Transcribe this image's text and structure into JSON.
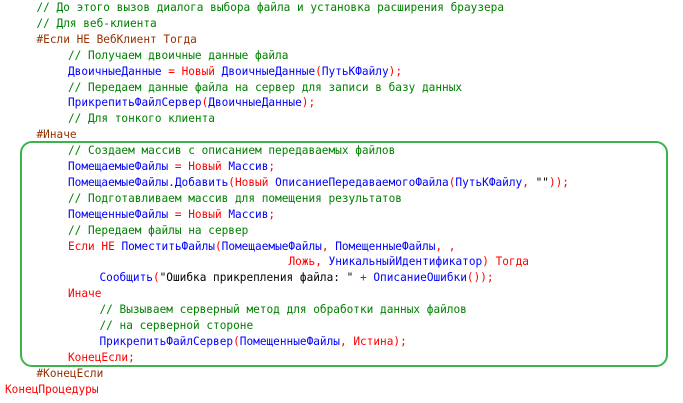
{
  "editor": {
    "colors": {
      "comment": "#008000",
      "keyword": "#ff0000",
      "identifier": "#0000ff",
      "string": "#000000",
      "preprocessor": "#963200",
      "highlight_frame": "#3cb44b"
    },
    "lines": [
      {
        "indent": 1,
        "tokens": [
          {
            "t": "comment",
            "v": "// До этого вызов диалога выбора файла и установка расширения браузера"
          }
        ]
      },
      {
        "indent": 1,
        "tokens": [
          {
            "t": "comment",
            "v": "// Для веб-клиента"
          }
        ]
      },
      {
        "indent": 1,
        "tokens": [
          {
            "t": "preproc",
            "v": "#Если НЕ ВебКлиент Тогда"
          }
        ]
      },
      {
        "indent": 2,
        "tokens": [
          {
            "t": "comment",
            "v": "// Получаем двоичные данные файла"
          }
        ]
      },
      {
        "indent": 2,
        "tokens": [
          {
            "t": "ident",
            "v": "ДвоичныеДанные "
          },
          {
            "t": "op",
            "v": "="
          },
          {
            "t": "ident",
            "v": " "
          },
          {
            "t": "keyword",
            "v": "Новый"
          },
          {
            "t": "ident",
            "v": " ДвоичныеДанные"
          },
          {
            "t": "op",
            "v": "("
          },
          {
            "t": "ident",
            "v": "ПутьКФайлу"
          },
          {
            "t": "op",
            "v": ");"
          }
        ]
      },
      {
        "indent": 2,
        "tokens": [
          {
            "t": "comment",
            "v": "// Передаем данные файла на сервер для записи в базу данных"
          }
        ]
      },
      {
        "indent": 2,
        "tokens": [
          {
            "t": "ident",
            "v": "ПрикрепитьФайлСервер"
          },
          {
            "t": "op",
            "v": "("
          },
          {
            "t": "ident",
            "v": "ДвоичныеДанные"
          },
          {
            "t": "op",
            "v": ");"
          }
        ]
      },
      {
        "indent": 2,
        "tokens": [
          {
            "t": "comment",
            "v": "// Для тонкого клиента"
          }
        ]
      },
      {
        "indent": 1,
        "tokens": [
          {
            "t": "preproc",
            "v": "#Иначе"
          }
        ]
      },
      {
        "indent": 2,
        "tokens": [
          {
            "t": "comment",
            "v": "// Создаем массив с описанием передаваемых файлов"
          }
        ]
      },
      {
        "indent": 2,
        "tokens": [
          {
            "t": "ident",
            "v": "ПомещаемыеФайлы "
          },
          {
            "t": "op",
            "v": "="
          },
          {
            "t": "ident",
            "v": " "
          },
          {
            "t": "keyword",
            "v": "Новый"
          },
          {
            "t": "ident",
            "v": " Массив"
          },
          {
            "t": "op",
            "v": ";"
          }
        ]
      },
      {
        "indent": 2,
        "tokens": [
          {
            "t": "ident",
            "v": "ПомещаемыеФайлы.Добавить"
          },
          {
            "t": "op",
            "v": "("
          },
          {
            "t": "keyword",
            "v": "Новый"
          },
          {
            "t": "ident",
            "v": " ОписаниеПередаваемогоФайла"
          },
          {
            "t": "op",
            "v": "("
          },
          {
            "t": "ident",
            "v": "ПутьКФайлу"
          },
          {
            "t": "op",
            "v": ", "
          },
          {
            "t": "string",
            "v": "\"\""
          },
          {
            "t": "op",
            "v": "));"
          }
        ]
      },
      {
        "indent": 2,
        "tokens": [
          {
            "t": "comment",
            "v": "// Подготавливаем массив для помещения результатов"
          }
        ]
      },
      {
        "indent": 2,
        "tokens": [
          {
            "t": "ident",
            "v": "ПомещенныеФайлы "
          },
          {
            "t": "op",
            "v": "="
          },
          {
            "t": "ident",
            "v": " "
          },
          {
            "t": "keyword",
            "v": "Новый"
          },
          {
            "t": "ident",
            "v": " Массив"
          },
          {
            "t": "op",
            "v": ";"
          }
        ]
      },
      {
        "indent": 2,
        "tokens": [
          {
            "t": "comment",
            "v": "// Передаем файлы на сервер"
          }
        ]
      },
      {
        "indent": 2,
        "tokens": [
          {
            "t": "keyword",
            "v": "Если НЕ"
          },
          {
            "t": "ident",
            "v": " ПоместитьФайлы"
          },
          {
            "t": "op",
            "v": "("
          },
          {
            "t": "ident",
            "v": "ПомещаемыеФайлы"
          },
          {
            "t": "op",
            "v": ", "
          },
          {
            "t": "ident",
            "v": "ПомещенныеФайлы"
          },
          {
            "t": "op",
            "v": ", ,"
          }
        ]
      },
      {
        "indent": 9,
        "tokens": [
          {
            "t": "keyword",
            "v": "Ложь"
          },
          {
            "t": "op",
            "v": ", "
          },
          {
            "t": "ident",
            "v": "УникальныйИдентификатор"
          },
          {
            "t": "op",
            "v": ")"
          },
          {
            "t": "ident",
            "v": " "
          },
          {
            "t": "keyword",
            "v": "Тогда"
          }
        ]
      },
      {
        "indent": 3,
        "tokens": [
          {
            "t": "ident",
            "v": "Сообщить"
          },
          {
            "t": "op",
            "v": "("
          },
          {
            "t": "string",
            "v": "\"Ошибка прикрепления файла: \""
          },
          {
            "t": "ident",
            "v": " "
          },
          {
            "t": "op",
            "v": "+"
          },
          {
            "t": "ident",
            "v": " ОписаниеОшибки"
          },
          {
            "t": "op",
            "v": "());"
          }
        ]
      },
      {
        "indent": 2,
        "tokens": [
          {
            "t": "keyword",
            "v": "Иначе"
          }
        ]
      },
      {
        "indent": 3,
        "tokens": [
          {
            "t": "comment",
            "v": "// Вызываем серверный метод для обработки данных файлов"
          }
        ]
      },
      {
        "indent": 3,
        "tokens": [
          {
            "t": "comment",
            "v": "// на серверной стороне"
          }
        ]
      },
      {
        "indent": 3,
        "tokens": [
          {
            "t": "ident",
            "v": "ПрикрепитьФайлСервер"
          },
          {
            "t": "op",
            "v": "("
          },
          {
            "t": "ident",
            "v": "ПомещенныеФайлы"
          },
          {
            "t": "op",
            "v": ", "
          },
          {
            "t": "keyword",
            "v": "Истина"
          },
          {
            "t": "op",
            "v": ");"
          }
        ]
      },
      {
        "indent": 2,
        "tokens": [
          {
            "t": "keyword",
            "v": "КонецЕсли"
          },
          {
            "t": "op",
            "v": ";"
          }
        ]
      },
      {
        "indent": 1,
        "tokens": [
          {
            "t": "preproc",
            "v": "#КонецЕсли"
          }
        ]
      },
      {
        "indent": 0,
        "tokens": [
          {
            "t": "keyword",
            "v": "КонецПроцедуры"
          }
        ]
      }
    ]
  }
}
